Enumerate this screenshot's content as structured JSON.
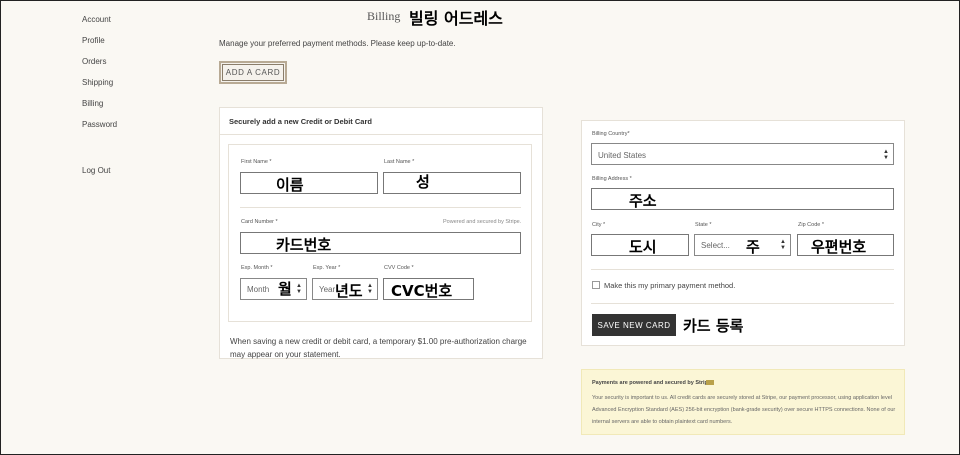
{
  "sidebar": {
    "items": [
      {
        "label": "Account"
      },
      {
        "label": "Profile"
      },
      {
        "label": "Orders"
      },
      {
        "label": "Shipping"
      },
      {
        "label": "Billing"
      },
      {
        "label": "Password"
      }
    ],
    "logout": "Log Out"
  },
  "header": {
    "title": "Billing",
    "annotation": "빌링 어드레스",
    "intro": "Manage your preferred payment methods. Please keep up-to-date.",
    "add_card": "ADD A CARD"
  },
  "card_form": {
    "heading": "Securely add a new Credit or Debit Card",
    "first_name_label": "First Name *",
    "first_name_note": "이름",
    "last_name_label": "Last Name *",
    "last_name_note": "성",
    "card_number_label": "Card Number *",
    "powered_by": "Powered and secured by Stripe.",
    "card_number_note": "카드번호",
    "exp_month_label": "Exp. Month *",
    "exp_month_value": "Month",
    "exp_month_note": "월",
    "exp_year_label": "Exp. Year *",
    "exp_year_value": "Year",
    "exp_year_note": "년도",
    "cvv_label": "CVV Code *",
    "cvv_note": "CVC번호",
    "note": "When saving a new credit or debit card, a temporary $1.00 pre-authorization charge may appear on your statement."
  },
  "billing_form": {
    "country_label": "Billing Country*",
    "country_value": "United States",
    "address_label": "Billing Address *",
    "address_note": "주소",
    "city_label": "City *",
    "city_note": "도시",
    "state_label": "State *",
    "state_value": "Select...",
    "state_note": "주",
    "zip_label": "Zip Code *",
    "zip_note": "우편번호",
    "primary_label": "Make this my primary payment method.",
    "save_button": "SAVE NEW CARD",
    "save_note": "카드 등록"
  },
  "info": {
    "title": "Payments are powered and secured by Stripe",
    "body": "Your security is important to us. All credit cards are securely stored at Stripe, our payment processor, using application level Advanced Encryption Standard (AES) 256-bit encryption (bank-grade security) over secure HTTPS connections. None of our internal servers are able to obtain plaintext card numbers."
  }
}
